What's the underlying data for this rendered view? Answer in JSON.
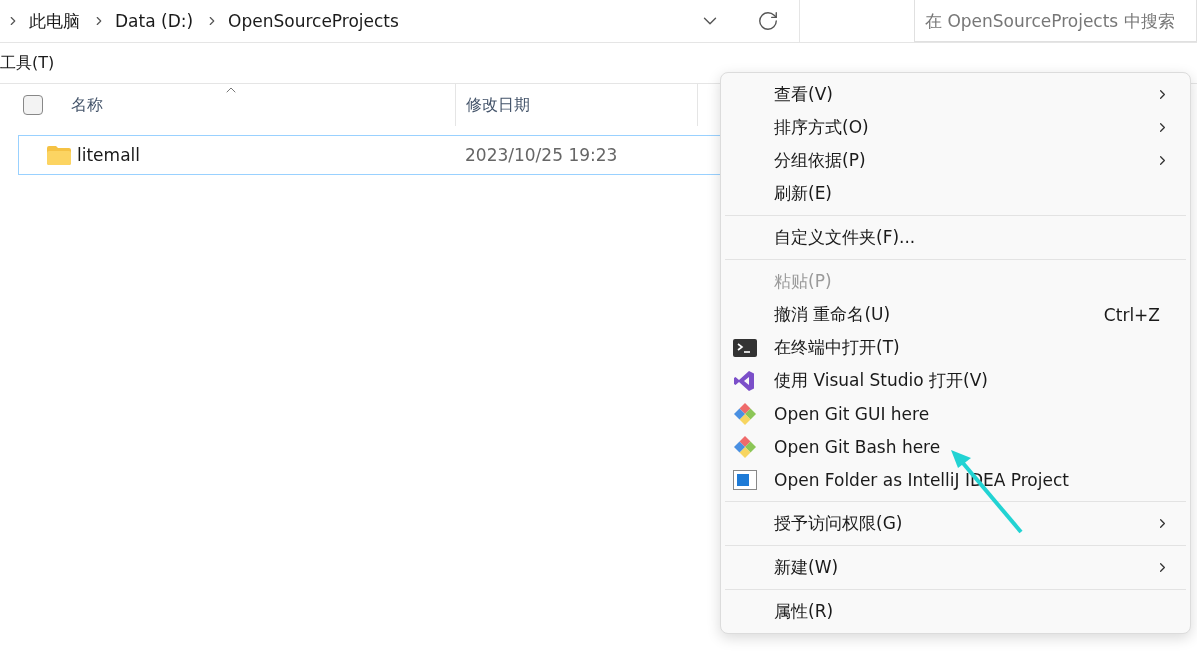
{
  "breadcrumb": [
    "此电脑",
    "Data (D:)",
    "OpenSourceProjects"
  ],
  "search": {
    "placeholder": "在 OpenSourceProjects 中搜索"
  },
  "menubar": [
    "工具(T)"
  ],
  "table": {
    "columns": [
      {
        "label": "名称",
        "sorted": true
      },
      {
        "label": "修改日期",
        "sorted": false
      }
    ],
    "select_all": {
      "checked": false
    },
    "rows": [
      {
        "name": "litemall",
        "modified": "2023/10/25 19:23",
        "selected": true
      }
    ]
  },
  "context_menu": {
    "groups": [
      [
        {
          "kind": "plain",
          "label": "查看(V)",
          "submenu": true,
          "disabled": false
        },
        {
          "kind": "plain",
          "label": "排序方式(O)",
          "submenu": true,
          "disabled": false
        },
        {
          "kind": "plain",
          "label": "分组依据(P)",
          "submenu": true,
          "disabled": false
        },
        {
          "kind": "plain",
          "label": "刷新(E)",
          "submenu": false,
          "disabled": false
        }
      ],
      [
        {
          "kind": "plain",
          "label": "自定义文件夹(F)...",
          "submenu": false,
          "disabled": false
        }
      ],
      [
        {
          "kind": "plain",
          "label": "粘贴(P)",
          "submenu": false,
          "disabled": true
        },
        {
          "kind": "plain",
          "label": "撤消 重命名(U)",
          "shortcut": "Ctrl+Z",
          "submenu": false,
          "disabled": false
        },
        {
          "kind": "terminal",
          "label": "在终端中打开(T)",
          "submenu": false,
          "disabled": false
        },
        {
          "kind": "visualstudio",
          "label": "使用 Visual Studio 打开(V)",
          "submenu": false,
          "disabled": false
        },
        {
          "kind": "git",
          "label": "Open Git GUI here",
          "submenu": false,
          "disabled": false
        },
        {
          "kind": "git",
          "label": "Open Git Bash here",
          "submenu": false,
          "disabled": false
        },
        {
          "kind": "window",
          "label": "Open Folder as IntelliJ IDEA Project",
          "submenu": false,
          "disabled": false
        }
      ],
      [
        {
          "kind": "plain",
          "label": "授予访问权限(G)",
          "submenu": true,
          "disabled": false
        }
      ],
      [
        {
          "kind": "plain",
          "label": "新建(W)",
          "submenu": true,
          "disabled": false
        }
      ],
      [
        {
          "kind": "plain",
          "label": "属性(R)",
          "submenu": false,
          "disabled": false
        }
      ]
    ]
  }
}
